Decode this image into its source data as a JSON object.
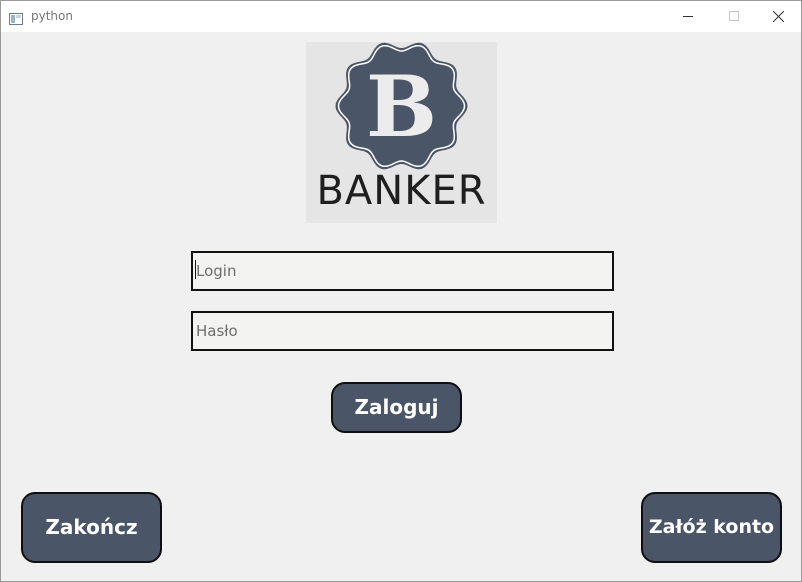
{
  "window": {
    "title": "python",
    "app_icon": "python-app-icon",
    "controls": {
      "minimize_icon": "minimize-icon",
      "maximize_icon": "maximize-icon",
      "close_icon": "close-icon"
    }
  },
  "logo": {
    "letter": "B",
    "text": "BANKER",
    "badge_color": "#4a5568"
  },
  "form": {
    "login": {
      "value": "",
      "placeholder": "Login"
    },
    "password": {
      "value": "",
      "placeholder": "Hasło"
    }
  },
  "buttons": {
    "login_label": "Zaloguj",
    "exit_label": "Zakończ",
    "register_label": "Załóż konto"
  },
  "colors": {
    "button_bg": "#4a5568",
    "button_text": "#ffffff",
    "window_bg": "#f0f0f0"
  }
}
